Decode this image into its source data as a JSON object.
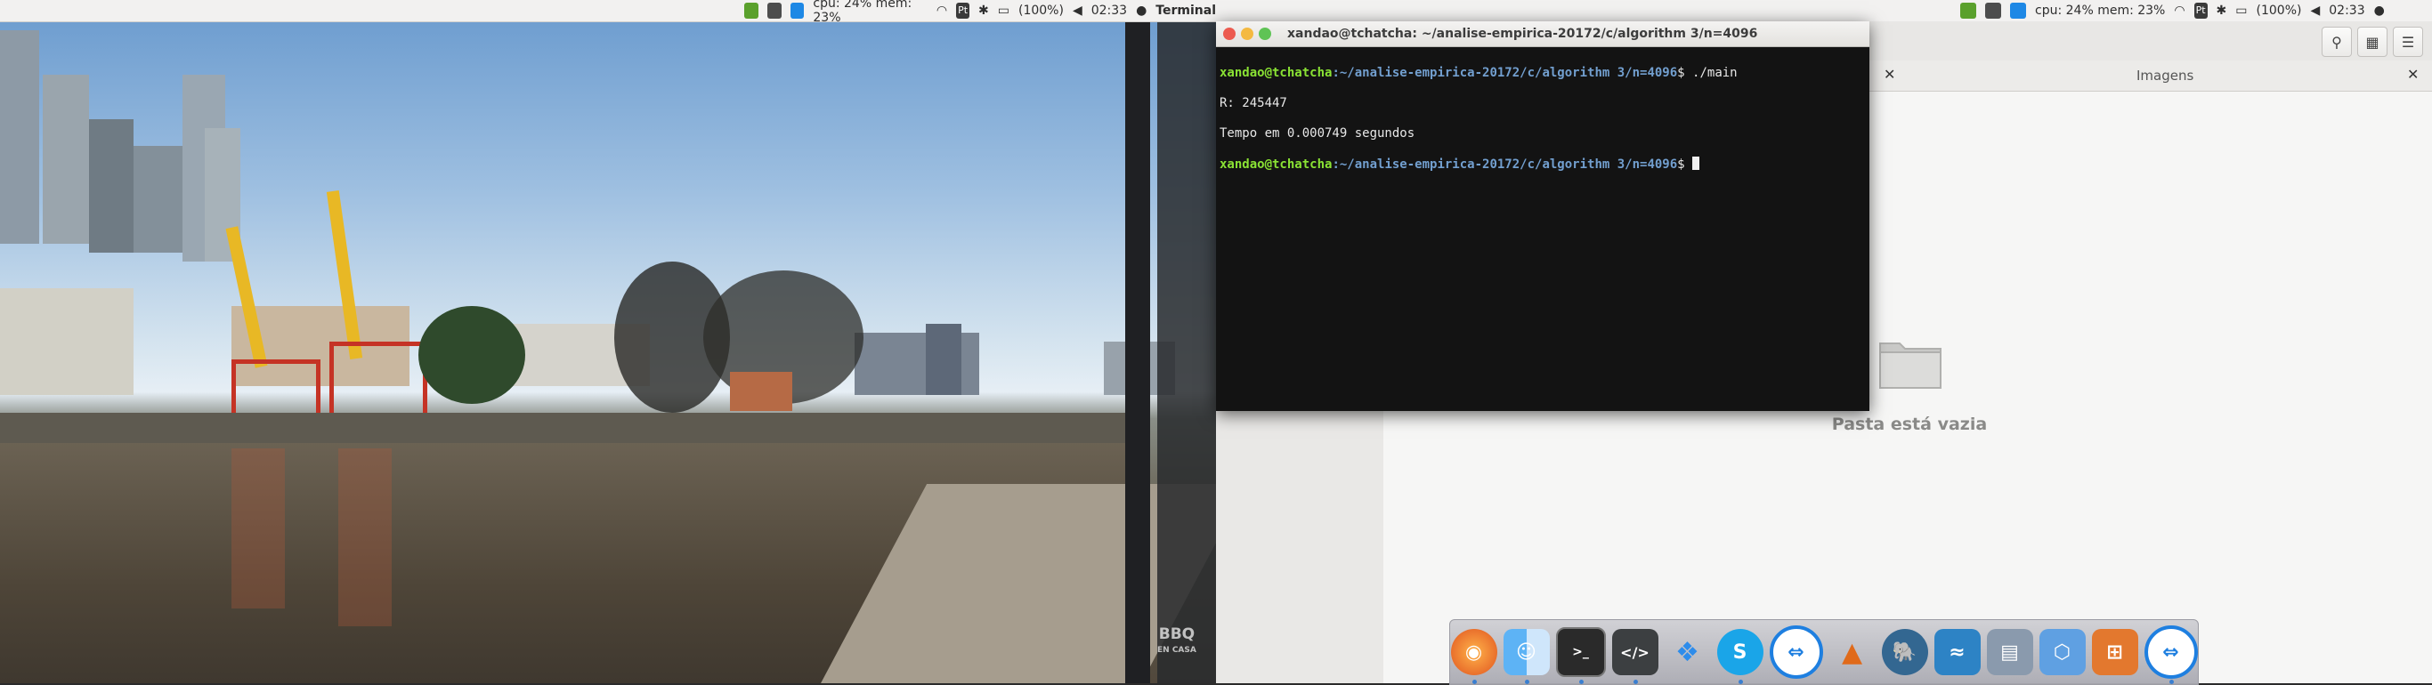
{
  "top_panel_left": {
    "cpu_mem": "cpu: 24% mem: 23%",
    "lang": "Pt",
    "battery": "(100%)",
    "time": "02:33",
    "app_title": "Terminal"
  },
  "top_panel_right": {
    "cpu_mem": "cpu: 24% mem: 23%",
    "lang": "Pt",
    "battery": "(100%)",
    "time": "02:33"
  },
  "terminal": {
    "title": "xandao@tchatcha: ~/analise-empirica-20172/c/algorithm 3/n=4096",
    "lines": [
      {
        "user": "xandao@tchatcha",
        "path": ":~/analise-empirica-20172/c/algorithm 3/n=4096",
        "cmd": "$ ./main"
      },
      {
        "out": "R: 245447"
      },
      {
        "out": "Tempo em 0.000749 segundos"
      },
      {
        "user": "xandao@tchatcha",
        "path": ":~/analise-empirica-20172/c/algorithm 3/n=4096",
        "cmd": "$ "
      }
    ]
  },
  "file_manager": {
    "tab_label": "Imagens",
    "empty_text": "Pasta está vazia"
  },
  "wallpaper": {
    "watermark_main": "BBQ",
    "watermark_sub": "EN CASA"
  },
  "dock": {
    "items": [
      "firefox",
      "finder",
      "terminal",
      "code-editor",
      "dropbox",
      "skype",
      "teamviewer",
      "matlab",
      "postgresql",
      "mysql-workbench",
      "scanner",
      "virtualbox",
      "multiplayer",
      "teamviewer"
    ]
  }
}
